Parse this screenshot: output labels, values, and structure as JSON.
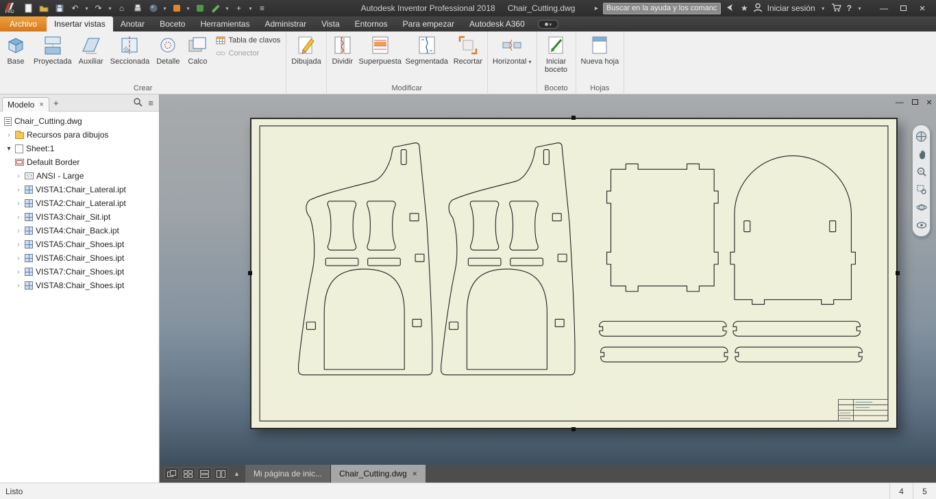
{
  "icons": {
    "close": "×",
    "plus": "+",
    "caret": "▾",
    "undo": "↶",
    "redo": "↷",
    "home": "⌂",
    "star": "★",
    "help": "?",
    "minimize": "—",
    "hamburger": "≡",
    "arrow_play": "▸",
    "up_triangle": "▲",
    "chevron": "›",
    "expanded": "▾",
    "logo_label": "PRO"
  },
  "titlebar": {
    "app_title": "Autodesk Inventor Professional 2018",
    "doc_title": "Chair_Cutting.dwg",
    "search_placeholder": "Buscar en la ayuda y los comanc",
    "sign_in": "Iniciar sesión"
  },
  "tabs": {
    "archivo": "Archivo",
    "insertar": "Insertar vistas",
    "anotar": "Anotar",
    "boceto": "Boceto",
    "herramientas": "Herramientas",
    "administrar": "Administrar",
    "vista": "Vista",
    "entornos": "Entornos",
    "para_empezar": "Para empezar",
    "a360": "Autodesk A360"
  },
  "ribbon": {
    "crear": {
      "label": "Crear",
      "base": "Base",
      "proyectada": "Proyectada",
      "auxiliar": "Auxiliar",
      "seccionada": "Seccionada",
      "detalle": "Detalle",
      "calco": "Calco",
      "tabla_clavos": "Tabla de clavos",
      "conector": "Conector"
    },
    "dibujada": {
      "label": "",
      "button": "Dibujada"
    },
    "modificar": {
      "label": "Modificar",
      "dividir": "Dividir",
      "superpuesta": "Superpuesta",
      "segmentada": "Segmentada",
      "recortar": "Recortar"
    },
    "horizontal": {
      "label": "",
      "button": "Horizontal"
    },
    "boceto_grp": {
      "label": "Boceto",
      "iniciar": "Iniciar boceto"
    },
    "hojas": {
      "label": "Hojas",
      "nueva": "Nueva hoja"
    }
  },
  "browser": {
    "panel_tab": "Modelo",
    "tree": [
      {
        "label": "Chair_Cutting.dwg"
      },
      {
        "label": "Recursos para dibujos"
      },
      {
        "label": "Sheet:1"
      },
      {
        "label": "Default Border"
      },
      {
        "label": "ANSI - Large"
      },
      {
        "label": "VISTA1:Chair_Lateral.ipt"
      },
      {
        "label": "VISTA2:Chair_Lateral.ipt"
      },
      {
        "label": "VISTA3:Chair_Sit.ipt"
      },
      {
        "label": "VISTA4:Chair_Back.ipt"
      },
      {
        "label": "VISTA5:Chair_Shoes.ipt"
      },
      {
        "label": "VISTA6:Chair_Shoes.ipt"
      },
      {
        "label": "VISTA7:Chair_Shoes.ipt"
      },
      {
        "label": "VISTA8:Chair_Shoes.ipt"
      }
    ]
  },
  "doc_tabs": {
    "home_tab": "Mi página de inic...",
    "active_tab": "Chair_Cutting.dwg"
  },
  "statusbar": {
    "status": "Listo",
    "page_a": "4",
    "page_b": "5"
  },
  "colors": {
    "archivo_tab": "#e08a2d",
    "sheet_fill": "#eef0d9",
    "canvas_top": "#a8aaac",
    "canvas_bottom": "#3d505f"
  }
}
